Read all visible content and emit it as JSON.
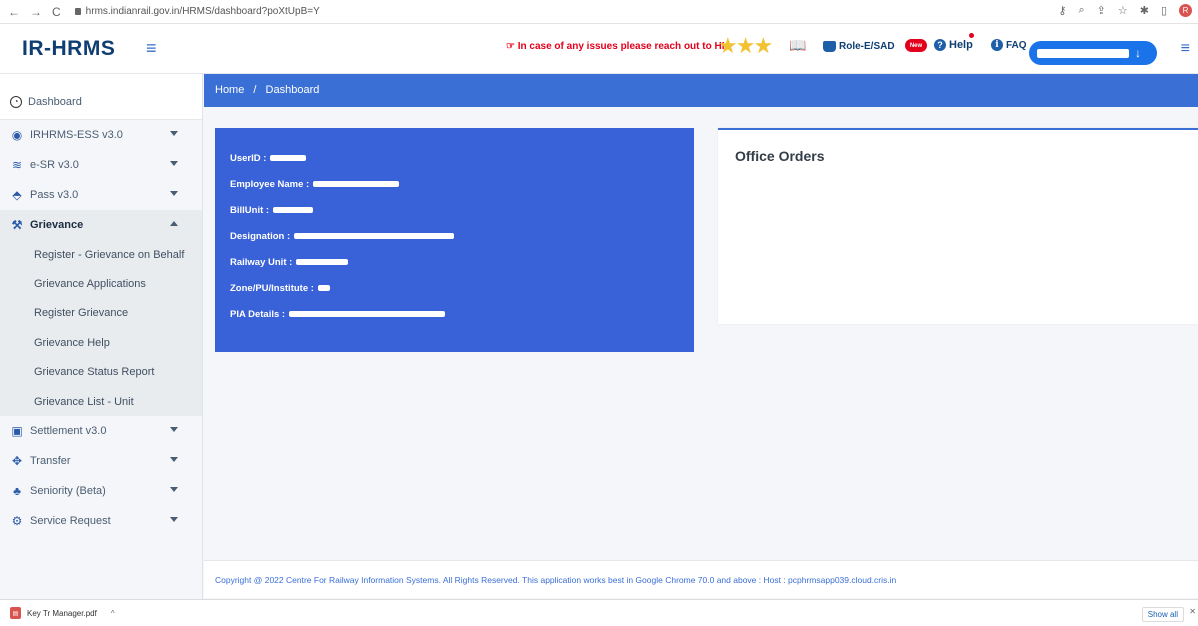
{
  "browser": {
    "url": "hrms.indianrail.gov.in/HRMS/dashboard?poXtUpB=Y",
    "profile_initial": "R"
  },
  "header": {
    "brand": "IR-HRMS",
    "notice": "☞ In case of any issues please reach out to HI",
    "stars": "★★★",
    "role_label": "Role-E/SAD",
    "new_badge": "New",
    "help_label": "Help",
    "faq_label": "FAQ"
  },
  "sidebar": {
    "dashboard": "Dashboard",
    "items": [
      {
        "label": "IRHRMS-ESS v3.0",
        "icon": "user-circle-icon"
      },
      {
        "label": "e-SR v3.0",
        "icon": "database-icon"
      },
      {
        "label": "Pass v3.0",
        "icon": "ticket-icon"
      }
    ],
    "grievance": "Grievance",
    "grievance_sub": [
      "Register - Grievance on Behalf",
      "Grievance Applications",
      "Register Grievance",
      "Grievance Help",
      "Grievance Status Report",
      "Grievance List - Unit"
    ],
    "bottom_items": [
      {
        "label": "Settlement v3.0",
        "icon": "money-icon"
      },
      {
        "label": "Transfer",
        "icon": "arrows-icon"
      },
      {
        "label": "Seniority (Beta)",
        "icon": "tree-icon"
      },
      {
        "label": "Service Request",
        "icon": "gears-icon"
      }
    ]
  },
  "breadcrumb": {
    "home": "Home",
    "separator": "/",
    "current": "Dashboard"
  },
  "user_card": {
    "fields": [
      {
        "label": "UserID :"
      },
      {
        "label": "Employee Name :"
      },
      {
        "label": "BillUnit :"
      },
      {
        "label": "Designation :"
      },
      {
        "label": "Railway Unit :"
      },
      {
        "label": "Zone/PU/Institute :"
      },
      {
        "label": "PIA Details :"
      }
    ]
  },
  "orders": {
    "title": "Office Orders"
  },
  "footer": {
    "text": "Copyright @ 2022 Centre For Railway Information Systems. All Rights Reserved. This application works best in Google Chrome 70.0 and above : Host : pcphrmsapp039.cloud.cris.in"
  },
  "downloads": {
    "file_name": "Key Tr Manager.pdf",
    "show_all": "Show all"
  }
}
